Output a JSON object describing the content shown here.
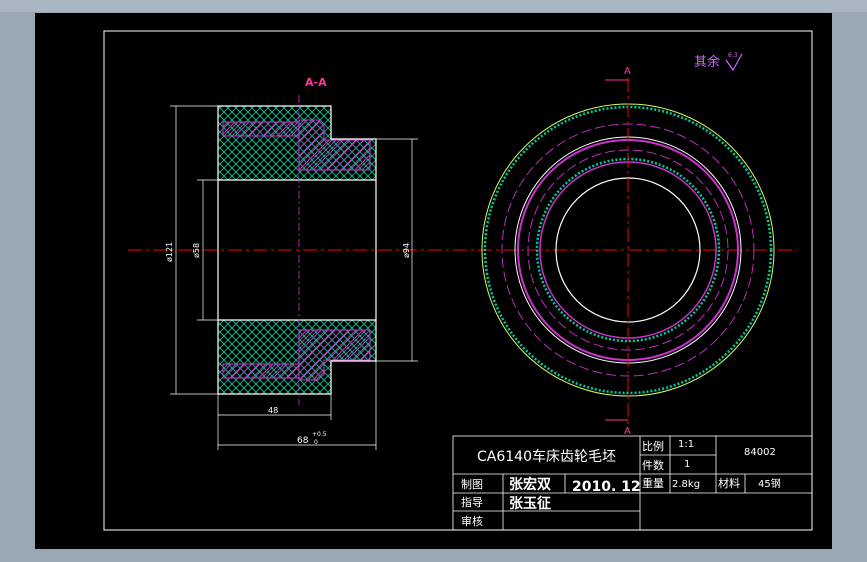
{
  "drawing": {
    "roughness_note": "其余",
    "roughness_symbol": "6.3",
    "section_title": "A-A",
    "section_marker_top": "A",
    "section_marker_bottom": "A",
    "dimensions": {
      "d121": "ø121",
      "d58": "ø58",
      "d94": "ø94",
      "len48": "48",
      "len68": "68",
      "tol_plus": "+0.5",
      "tol_zero": "0"
    }
  },
  "title_block": {
    "title": "CA6140车床齿轮毛坯",
    "scale_label": "比例",
    "scale_value": "1:1",
    "count_label": "件数",
    "count_value": "1",
    "drawing_number": "84002",
    "drawn_label": "制图",
    "drawn_by": "张宏双",
    "date": "2010. 12",
    "weight_label": "重量",
    "weight_value": "2.8kg",
    "material_label": "材料",
    "material_value": "45钢",
    "guide_label": "指导",
    "guide_by": "张玉征",
    "review_label": "审核"
  },
  "colors": {
    "background": "#000000",
    "frame": "#ffffff",
    "centerline": "#ff0000",
    "part_outline": "#ffffff",
    "hatch_green": "#00cc99",
    "hatch_magenta": "#cc33cc",
    "dimension": "#ffffff",
    "title_text": "#ffffff"
  }
}
